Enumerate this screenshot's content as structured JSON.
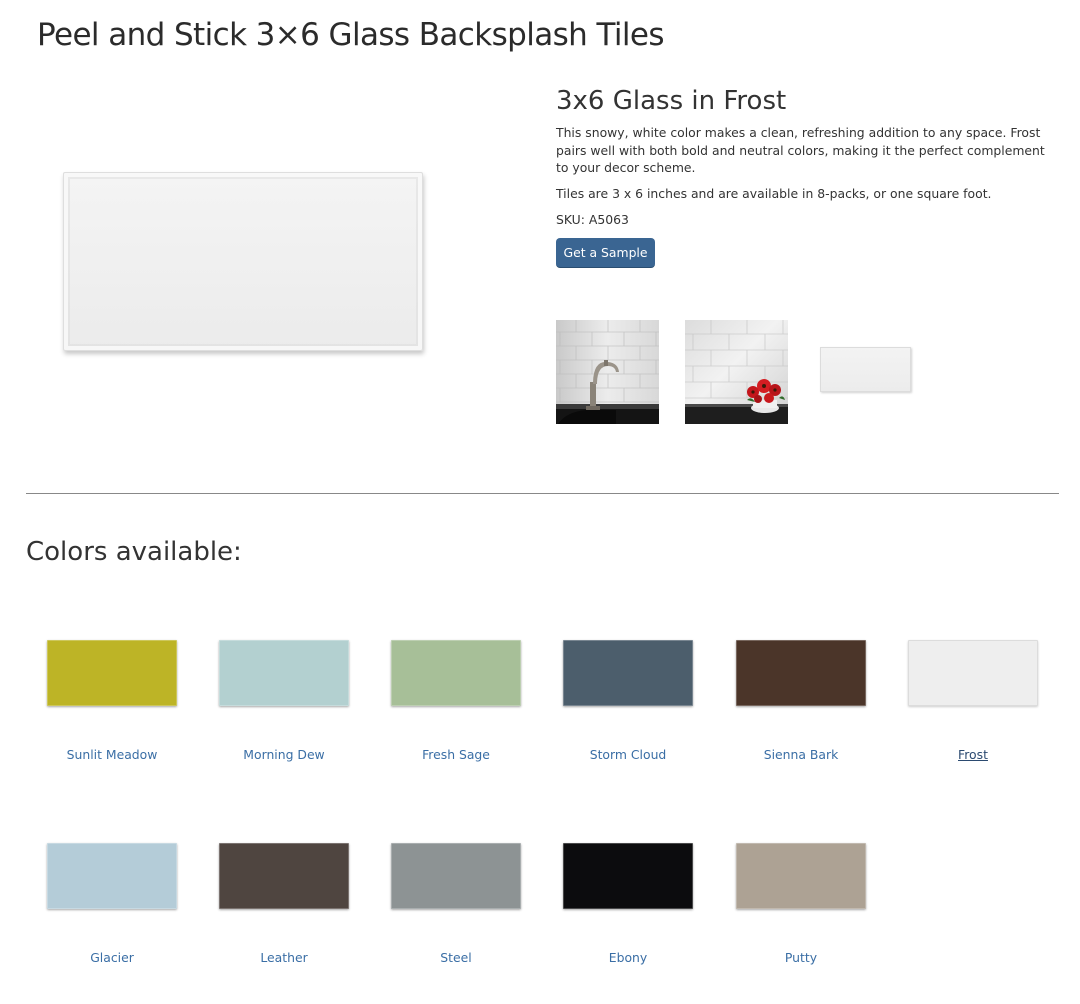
{
  "page_title": "Peel and Stick 3×6 Glass Backsplash Tiles",
  "product": {
    "title": "3x6 Glass in Frost",
    "description": "This snowy, white color makes a clean, refreshing addition to any space. Frost pairs well with both bold and neutral colors, making it the perfect complement to your decor scheme.",
    "size_text": "Tiles are 3 x 6 inches and are available in 8-packs, or one square foot.",
    "sku": "SKU: A5063",
    "sample_button": "Get a Sample",
    "main_image_color": "#efefef"
  },
  "thumbnails": [
    {
      "subject": "faucet-backsplash-photo"
    },
    {
      "subject": "flowers-backsplash-photo"
    },
    {
      "subject": "frost-tile-swatch",
      "color": "#eeeeee"
    }
  ],
  "colors_heading": "Colors available:",
  "colors": [
    {
      "name": "Sunlit Meadow",
      "color": "#bdb426",
      "current": false
    },
    {
      "name": "Morning Dew",
      "color": "#b3d0d0",
      "current": false
    },
    {
      "name": "Fresh Sage",
      "color": "#a7bf98",
      "current": false
    },
    {
      "name": "Storm Cloud",
      "color": "#4c5e6c",
      "current": false
    },
    {
      "name": "Sienna Bark",
      "color": "#4b3529",
      "current": false
    },
    {
      "name": "Frost",
      "color": "#eeeeee",
      "current": true
    },
    {
      "name": "Glacier",
      "color": "#b4ccd8",
      "current": false
    },
    {
      "name": "Leather",
      "color": "#4f4540",
      "current": false
    },
    {
      "name": "Steel",
      "color": "#8d9394",
      "current": false
    },
    {
      "name": "Ebony",
      "color": "#0c0c0e",
      "current": false
    },
    {
      "name": "Putty",
      "color": "#ada294",
      "current": false
    }
  ],
  "theme": {
    "link_color": "#3a6ea5",
    "button_color": "#3a6592"
  }
}
